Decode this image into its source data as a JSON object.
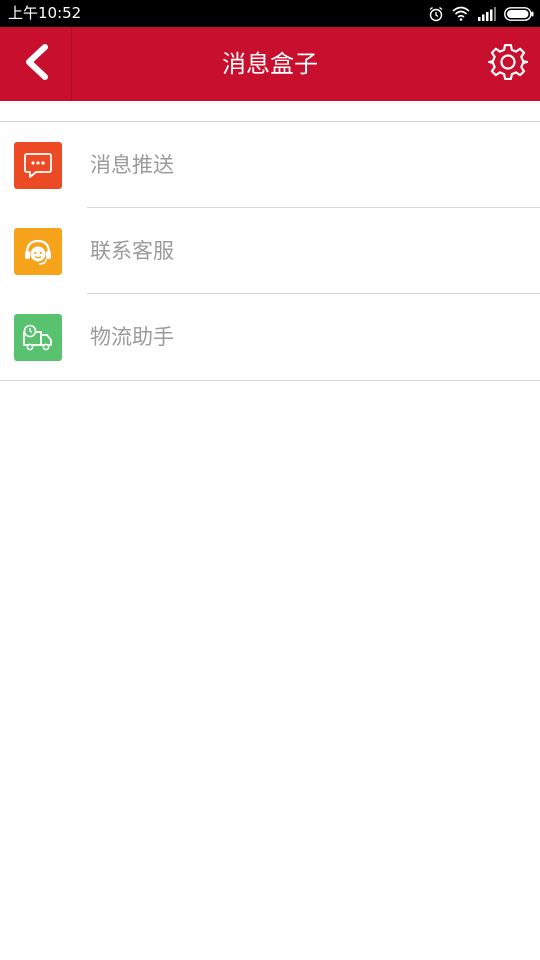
{
  "status_bar": {
    "time": "上午10:52",
    "icons": [
      "alarm-icon",
      "wifi-icon",
      "signal-icon",
      "battery-icon"
    ]
  },
  "header": {
    "title": "消息盒子",
    "back_icon": "chevron-left-icon",
    "settings_icon": "gear-icon",
    "background_color": "#c8102e"
  },
  "menu": {
    "items": [
      {
        "label": "消息推送",
        "icon": "message-bubble-icon",
        "color": "#ec4a25"
      },
      {
        "label": "联系客服",
        "icon": "customer-service-icon",
        "color": "#f5a31a"
      },
      {
        "label": "物流助手",
        "icon": "delivery-truck-icon",
        "color": "#59c26f"
      }
    ]
  }
}
